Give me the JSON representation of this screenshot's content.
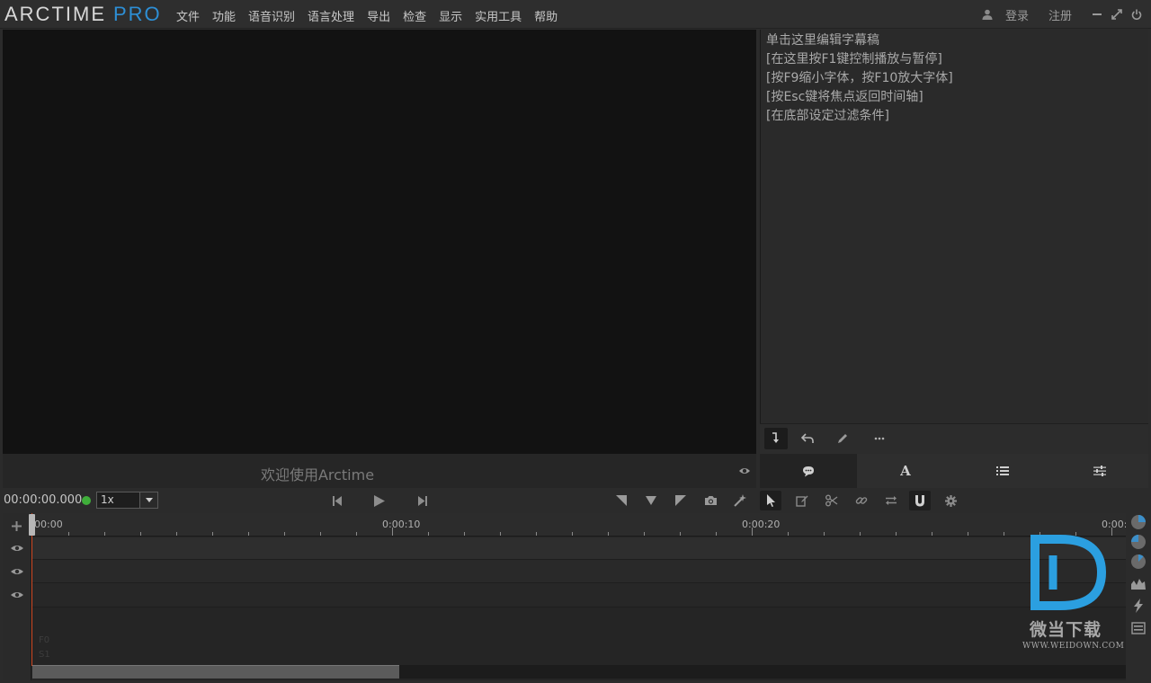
{
  "app": {
    "logo_main": "ARCTIME",
    "logo_pro": "PRO"
  },
  "menu": [
    "文件",
    "功能",
    "语音识别",
    "语言处理",
    "导出",
    "检查",
    "显示",
    "实用工具",
    "帮助"
  ],
  "account": {
    "login": "登录",
    "register": "注册"
  },
  "video": {
    "welcome": "欢迎使用Arctime"
  },
  "subtitle_hints": [
    "单击这里编辑字幕稿",
    "[在这里按F1键控制播放与暂停]",
    "[按F9缩小字体，按F10放大字体]",
    "[按Esc键将焦点返回时间轴]",
    "[在底部设定过滤条件]"
  ],
  "transport": {
    "timecode": "00:00:00.000",
    "speed": "1x"
  },
  "timeline": {
    "labels": [
      "00:00",
      "0:00:10",
      "0:00:20",
      "0:00:"
    ],
    "channel_labels": [
      "F0",
      "S1"
    ]
  },
  "watermark": {
    "cn": "微当下载",
    "url": "WWW.WEIDOWN.COM"
  },
  "colors": {
    "accent": "#2d8fd6",
    "playhead": "#d24a24",
    "status_ok": "#3fae3a"
  }
}
